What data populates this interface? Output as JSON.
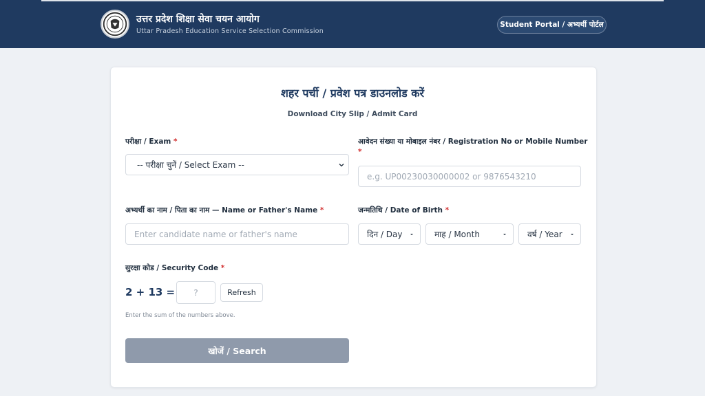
{
  "header": {
    "org_name_hindi": "उत्तर प्रदेश शिक्षा सेवा चयन आयोग",
    "org_name_english": "Uttar Pradesh Education Service Selection Commission",
    "portal_button": "Student Portal / अभ्यर्थी पोर्टल",
    "emblem_icon": "up-state-emblem-icon",
    "bg_color": "#1f3a60"
  },
  "form": {
    "title": "शहर पर्ची / प्रवेश पत्र डाउनलोड करें",
    "subtitle": "Download City Slip / Admit Card",
    "required_mark": "*",
    "exam": {
      "label": "परीक्षा / Exam",
      "selected": "-- परीक्षा चुनें / Select Exam --"
    },
    "registration": {
      "label": "आवेदन संख्या या मोबाइल नंबर / Registration No or Mobile Number",
      "placeholder": "e.g. UP00230030000002 or 9876543210"
    },
    "name": {
      "label": "अभ्यर्थी का नाम / पिता का नाम — Name or Father's Name",
      "placeholder": "Enter candidate name or father's name"
    },
    "dob": {
      "label": "जन्मतिथि / Date of Birth",
      "day": "दिन / Day",
      "month": "माह / Month",
      "year": "वर्ष / Year"
    },
    "captcha": {
      "label": "सुरक्षा कोड / Security Code",
      "expression": "2 + 13 =",
      "placeholder": "?",
      "refresh": "Refresh",
      "hint": "Enter the sum of the numbers above."
    },
    "search_button": "खोजें / Search",
    "search_button_color": "#8f9aab",
    "required_color": "#d22f2f"
  }
}
